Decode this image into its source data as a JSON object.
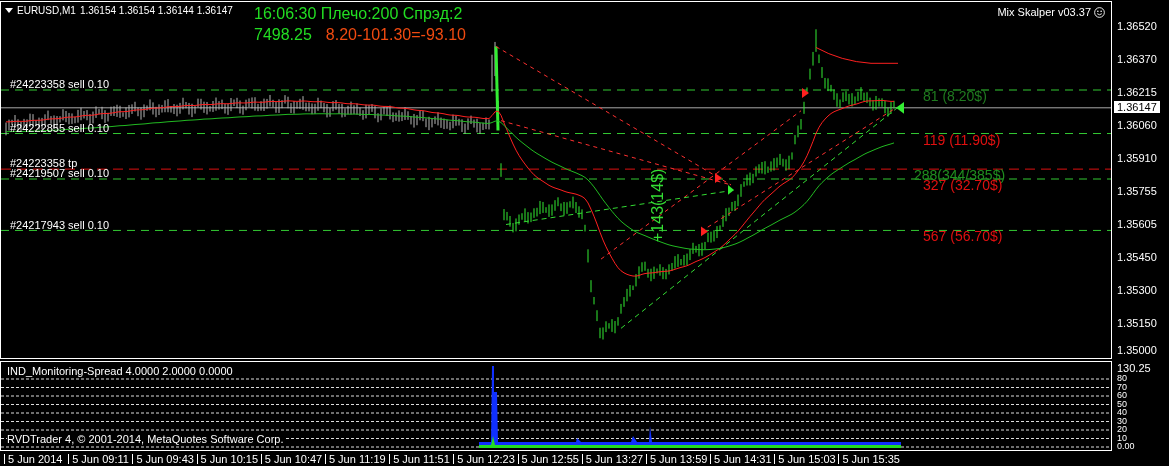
{
  "header": {
    "symbol": "EURUSD,M1",
    "quote": "1.36154 1.36154 1.36144 1.36147"
  },
  "info": {
    "status": "16:06:30 Плечо:200 Спрэд:2",
    "balance": "7498.25",
    "profit": "8.20-101.30=-93.10"
  },
  "expert": {
    "name": "Mix Skalper v03.37"
  },
  "orders": [
    {
      "label": "#24223358 sell 0.10",
      "kind": "sell"
    },
    {
      "label": "#24222855 sell 0.10",
      "kind": "sell"
    },
    {
      "label": "#24223358 tp",
      "kind": "tp"
    },
    {
      "label": "#24219507 sell 0.10",
      "kind": "sell"
    },
    {
      "label": "#24217943 sell 0.10",
      "kind": "sell"
    }
  ],
  "targets": [
    {
      "label": "81 (8.20$)",
      "color": "#1f7a1f"
    },
    {
      "label": "119 (11.90$)",
      "color": "#e01010"
    },
    {
      "label": "288(344/385$)",
      "color": "#1f8f1f"
    },
    {
      "label": "327 (32.70$)",
      "color": "#e01010"
    },
    {
      "label": "567 (56.70$)",
      "color": "#e01010"
    }
  ],
  "trade_labels": [
    {
      "label": "+143(14$)"
    }
  ],
  "price_axis": {
    "ticks": [
      "1.36520",
      "1.36370",
      "1.36215",
      "1.36060",
      "1.35910",
      "1.35755",
      "1.35605",
      "1.35450",
      "1.35300",
      "1.35150",
      "1.35000"
    ],
    "current": "1.36147"
  },
  "indicator": {
    "title": "IND_Monitoring-Spread 4.0000 2.0000 0.0000",
    "copyright": "RVDTrader 4, © 2001-2014, MetaQuotes Software Corp.",
    "max": "130.25",
    "ticks": [
      "80",
      "70",
      "60",
      "50",
      "40",
      "30",
      "20",
      "10",
      "0.00"
    ]
  },
  "time_axis": [
    "5 Jun 2014",
    "5 Jun 09:11",
    "5 Jun 09:43",
    "5 Jun 10:15",
    "5 Jun 10:47",
    "5 Jun 11:19",
    "5 Jun 11:51",
    "5 Jun 12:23",
    "5 Jun 12:55",
    "5 Jun 13:27",
    "5 Jun 13:59",
    "5 Jun 14:31",
    "5 Jun 15:03",
    "5 Jun 15:35"
  ]
}
